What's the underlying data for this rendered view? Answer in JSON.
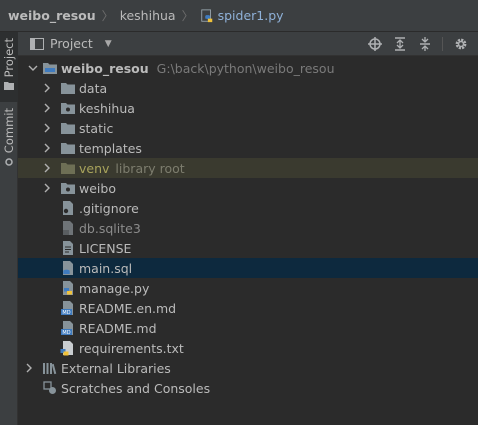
{
  "breadcrumb": {
    "project": "weibo_resou",
    "folder": "keshihua",
    "file": "spider1.py"
  },
  "toolstrip": {
    "project_tab": "Project",
    "commit_tab": "Commit"
  },
  "panel": {
    "title": "Project"
  },
  "tree": {
    "root_name": "weibo_resou",
    "root_path": "G:\\back\\python\\weibo_resou",
    "folders": [
      "data",
      "keshihua",
      "static",
      "templates",
      "venv",
      "weibo"
    ],
    "venv_hint": "library root",
    "files": [
      ".gitignore",
      "db.sqlite3",
      "LICENSE",
      "main.sql",
      "manage.py",
      "README.en.md",
      "README.md",
      "requirements.txt"
    ],
    "external_libraries": "External Libraries",
    "scratches": "Scratches and Consoles"
  },
  "colors": {
    "background": "#2b2b2b",
    "chrome": "#3c3f41",
    "selection": "#0d293e",
    "excluded_row": "#3a3a2f",
    "folder": "#87939a",
    "venv_text": "#a8a35c",
    "file_link": "#8fb1d8"
  },
  "icons": {
    "locate": "crosshair-icon",
    "expand_all": "expand-all-icon",
    "collapse_all": "collapse-all-icon",
    "settings": "gear-icon"
  }
}
